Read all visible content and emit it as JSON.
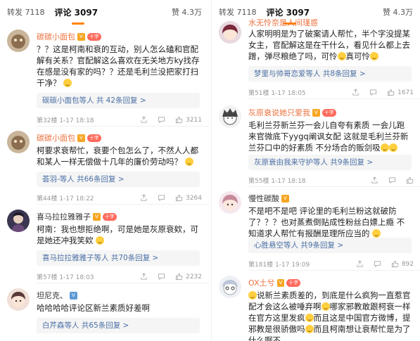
{
  "left": {
    "tabs": {
      "repost": "转发 7118",
      "comment": "评论 3097",
      "like": "赞 4.3万"
    },
    "comments": [
      {
        "user": "碳碳小面包",
        "text": "？？这是柯南和衰的互动，别人怎么磕和官配解有关系？官配解这么喜欢在无关地方ky找存在感是没有家的吗？？还是毛利兰没把家打扫干净？",
        "reply": "碳碳小面包等人  共 42条回复 >",
        "meta": "第32楼  1-17 18:18",
        "likes": "3211"
      },
      {
        "user": "碳碳小面包",
        "text": "柯要求衰帮忙，衰要个包怎么了，不然人人都和某人一样无偿做十几年的廉价劳动吗？",
        "reply": "荟羽-等人  共66条回复 >",
        "meta": "第44楼  1-17 18:22",
        "likes": "3264"
      },
      {
        "user": "喜马拉拉雅雅子",
        "text": "柯南：我也想拒绝啊，可是她是灰原衰欸，可是她还冲我笑欸",
        "reply": "喜马拉拉雅雅子等人  共70条回复 >",
        "meta": "第57楼  1-17 18:03",
        "likes": "2232"
      },
      {
        "user": "坦尼克、",
        "text": "哈哈哈哈评论区新兰素质好差啊",
        "reply": "白芹森等人  共65条回复 >",
        "meta": "",
        "likes": ""
      }
    ]
  },
  "right": {
    "tabs": {
      "repost": "转发 7118",
      "comment": "评论 3097",
      "like": "赞 4.3万"
    },
    "comments": [
      {
        "user": "水无怜奈是人间瑾惑",
        "text": "人家明明是为了破案请人帮忙，半个字没提某女主，官配解这是在干什么，看见什么都上去蹭，弹尽粮绝了吗，可怜",
        "text_tail": "真可怜",
        "reply": "梦里与帅哥恋爱等人  共8条回复 >",
        "meta": "第51楼  1-17 18:05",
        "likes": "1671"
      },
      {
        "user": "灰原衰说她只爱我",
        "text": "毛利兰芬新兰芬一会儿自夸有素质 一会儿跑来官微底下yygq阐讽女配 这就是毛利兰芬新兰芬口中的好素质 不分场合的贩剑吸",
        "reply": "灰原衰由我来守护等人  共9条回复 >",
        "meta": "第55楼  1-17 18:18",
        "likes": ""
      },
      {
        "user": "慢性碳酸",
        "text": "不是吧不是吧 评论里的毛利兰粉这就破防了？？？也对蒸煮倒贴成性粉丝白嫖上瘾 不知道求人帮忙有报酬是理所应当的",
        "reply": "心胜悬空等人  共9条回复 >",
        "meta": "第181楼  1-17 19:09",
        "likes": "892"
      },
      {
        "user": "OX土兮",
        "text": "说新兰素质差的，到底是什么疯狗一直惹官配才会这么被唾弃啊",
        "text2": "哪家邪教敢跟柯衰一样在官方这里发疯",
        "text3": "而且这是中国官方微博，提邪教是很骄傲吗",
        "text4": "而且柯南想让衰帮忙是为了什么啊不",
        "reply": "",
        "meta": "",
        "likes": ""
      }
    ]
  },
  "colors": {
    "username": "#eb7340",
    "link": "#4a6fa5",
    "accent": "#ff8200"
  }
}
